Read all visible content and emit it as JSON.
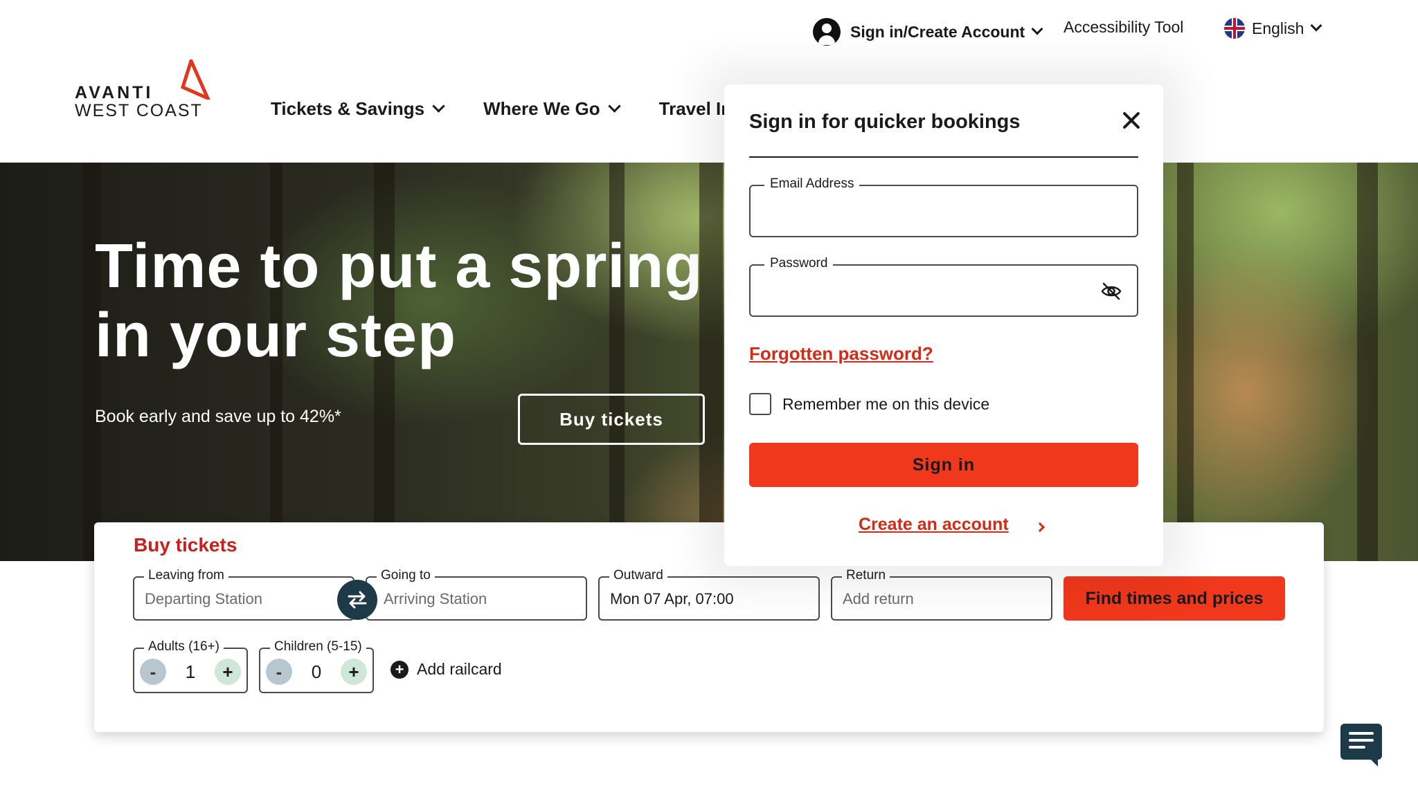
{
  "header": {
    "signin_label": "Sign in/Create Account",
    "accessibility_label": "Accessibility Tool",
    "language_label": "English"
  },
  "logo": {
    "line1": "AVANTI",
    "line2": "WEST COAST"
  },
  "nav": {
    "items": [
      {
        "label": "Tickets & Savings"
      },
      {
        "label": "Where We Go"
      },
      {
        "label": "Travel In"
      }
    ]
  },
  "hero": {
    "title_line1": "Time to put a spring",
    "title_line2": "in your step",
    "subtitle": "Book early and save up to 42%*",
    "cta_label": "Buy tickets"
  },
  "booking": {
    "title": "Buy tickets",
    "leaving": {
      "label": "Leaving from",
      "placeholder": "Departing Station"
    },
    "going": {
      "label": "Going to",
      "placeholder": "Arriving Station"
    },
    "outward": {
      "label": "Outward",
      "value": "Mon 07 Apr, 07:00"
    },
    "return": {
      "label": "Return",
      "placeholder": "Add return"
    },
    "find_label": "Find times and prices",
    "adults": {
      "label": "Adults (16+)",
      "value": "1",
      "minus": "-",
      "plus": "+"
    },
    "children": {
      "label": "Children (5-15)",
      "value": "0",
      "minus": "-",
      "plus": "+"
    },
    "railcard_label": "Add railcard"
  },
  "signin_popover": {
    "title": "Sign in for quicker bookings",
    "email_label": "Email Address",
    "password_label": "Password",
    "forgot_label": "Forgotten password?",
    "remember_label": "Remember me on this device",
    "signin_button": "Sign in",
    "create_account_label": "Create an account"
  },
  "colors": {
    "brand_red": "#f0381c",
    "link_red": "#d42a18",
    "dark_teal": "#1c3a48"
  },
  "icons": {
    "account": "user-circle-icon",
    "language": "uk-flag-icon",
    "close": "close-icon",
    "password_toggle": "eye-slash-icon",
    "swap": "swap-arrows-icon",
    "chat": "chat-icon"
  }
}
